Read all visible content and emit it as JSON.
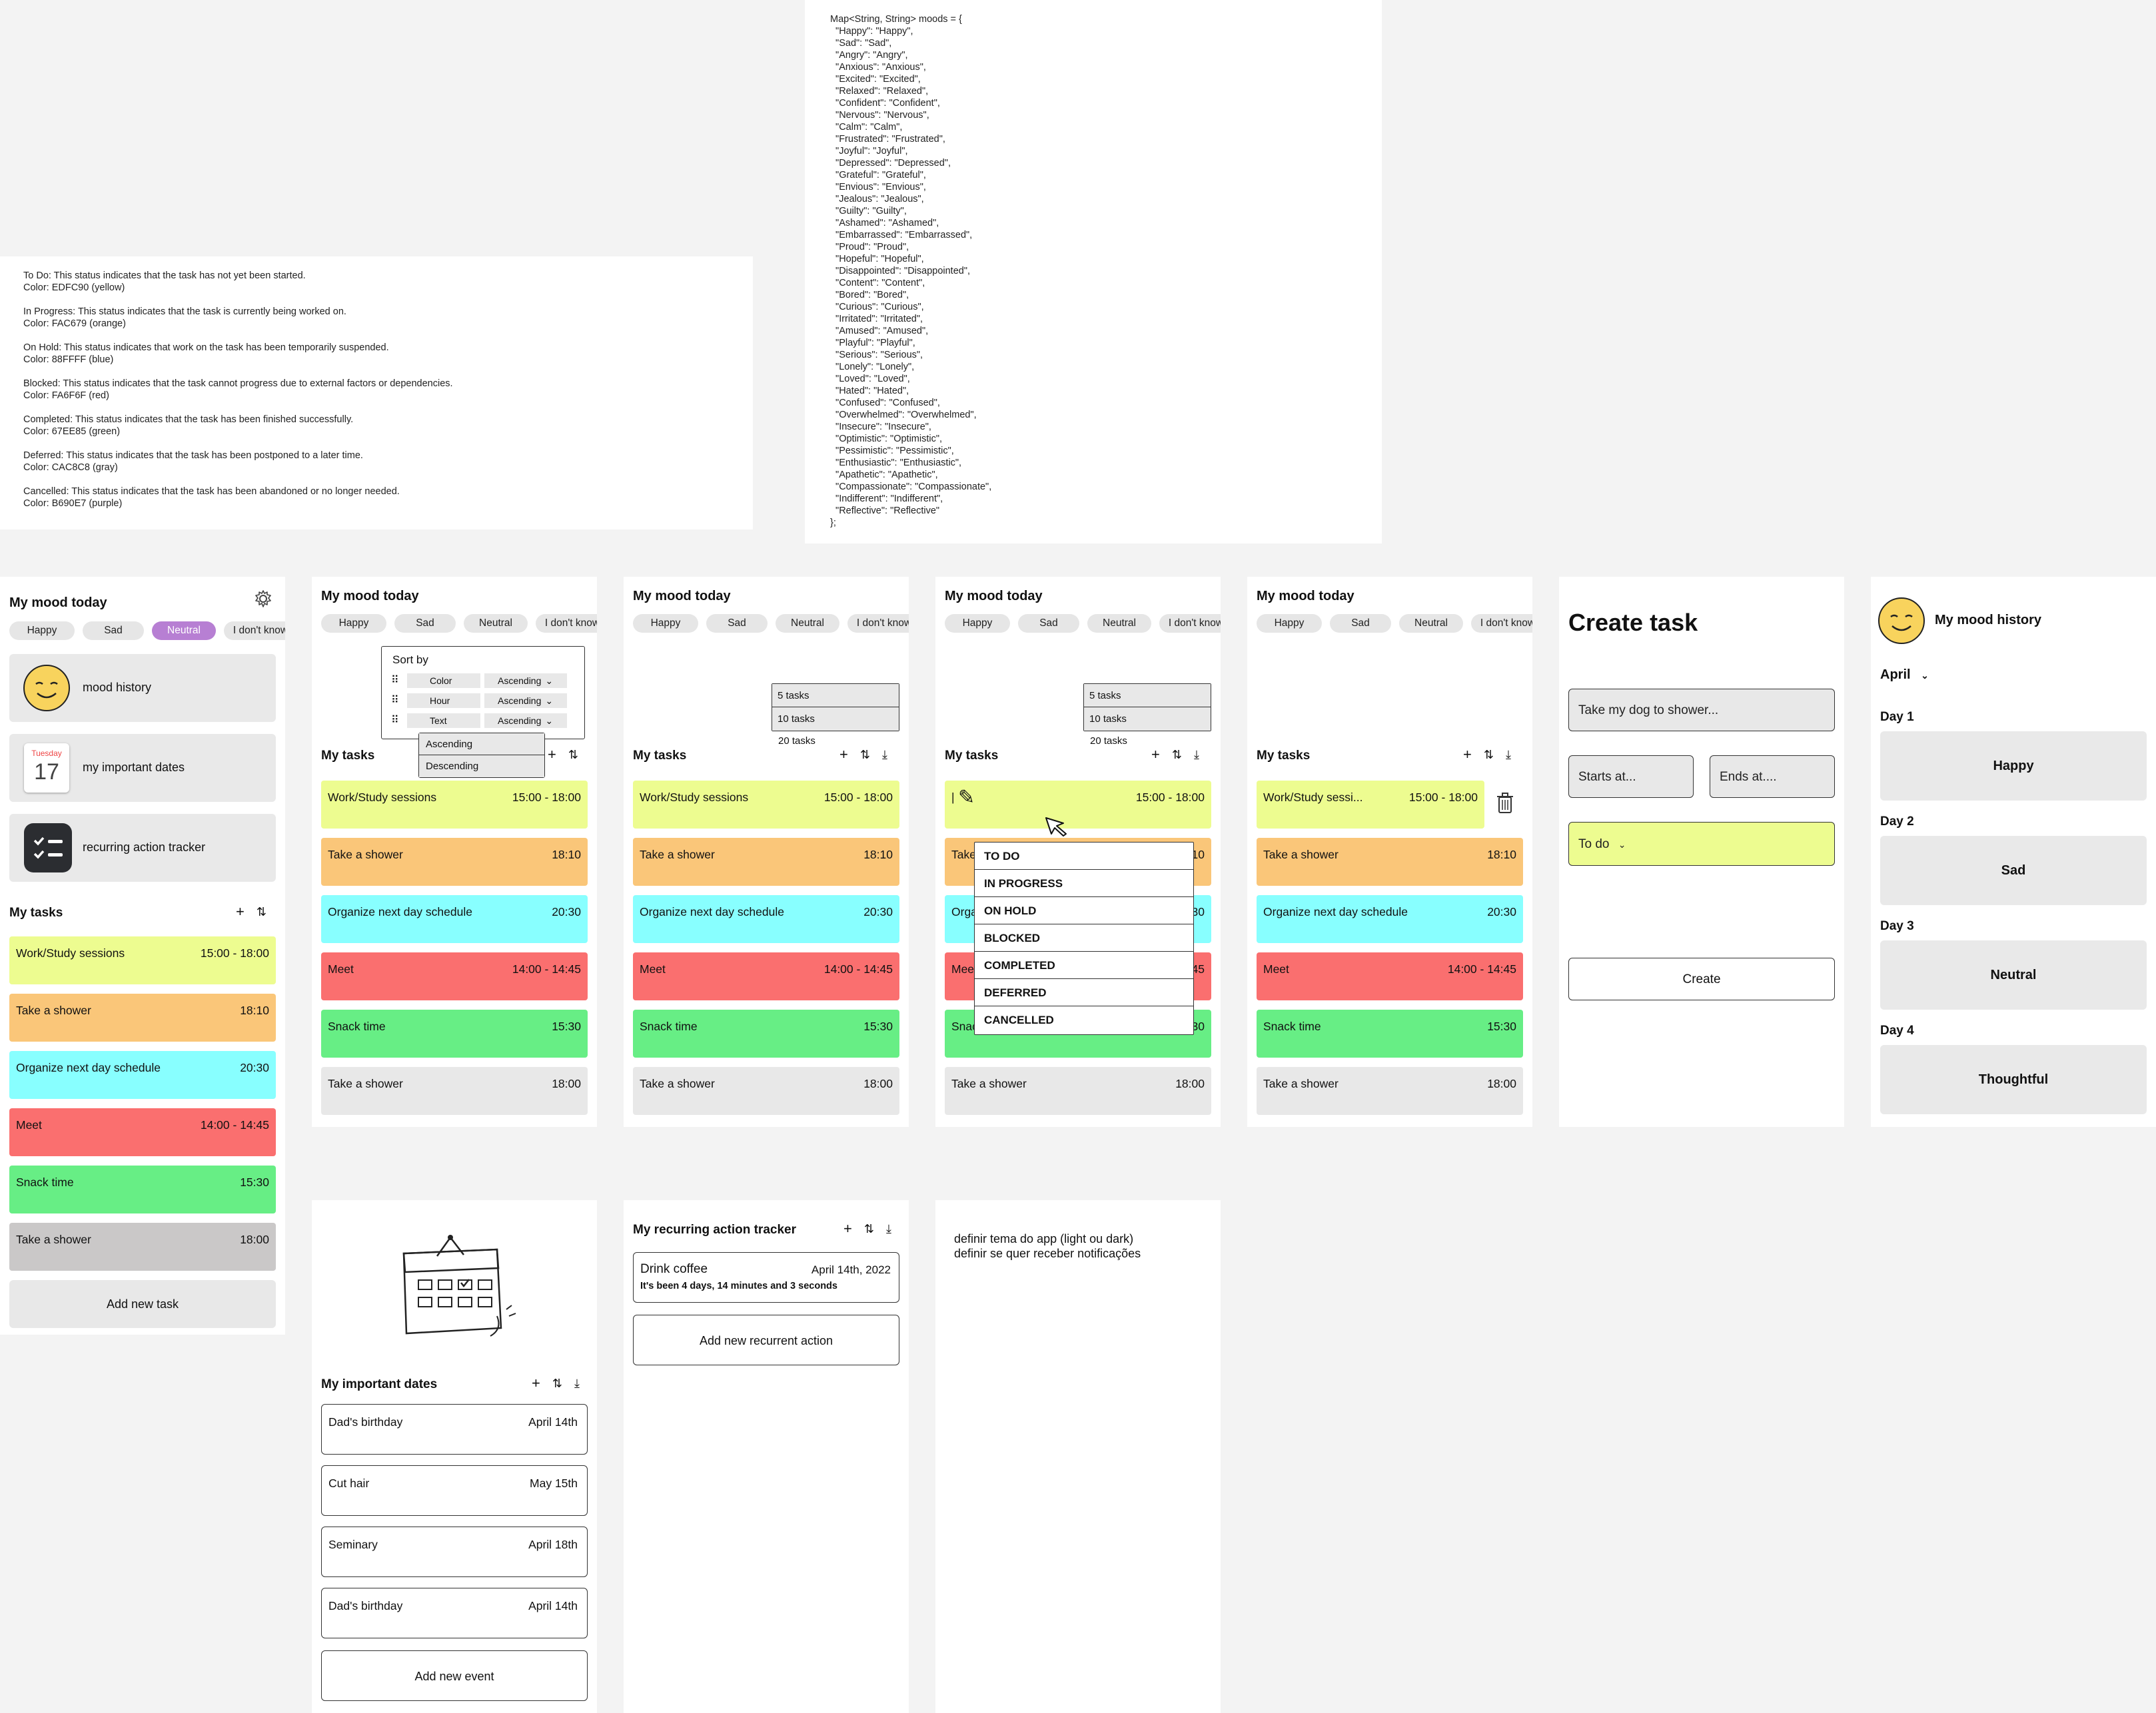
{
  "status_doc": {
    "lines": [
      "To Do: This status indicates that the task has not yet been started.",
      "Color: EDFC90 (yellow)",
      "",
      "In Progress: This status indicates that the task is currently being worked on.",
      "Color: FAC679 (orange)",
      "",
      "On Hold: This status indicates that work on the task has been temporarily suspended.",
      "Color: 88FFFF (blue)",
      "",
      "Blocked: This status indicates that the task cannot progress due to external factors or dependencies.",
      "Color: FA6F6F (red)",
      "",
      "Completed: This status indicates that the task has been finished successfully.",
      "Color: 67EE85 (green)",
      "",
      "Deferred: This status indicates that the task has been postponed to a later time.",
      "Color: CAC8C8 (gray)",
      "",
      "Cancelled: This status indicates that the task has been abandoned or no longer needed.",
      "Color: B690E7 (purple)"
    ]
  },
  "moods_doc": {
    "lines": [
      "Map<String, String> moods = {",
      "  \"Happy\": \"Happy\",",
      "  \"Sad\": \"Sad\",",
      "  \"Angry\": \"Angry\",",
      "  \"Anxious\": \"Anxious\",",
      "  \"Excited\": \"Excited\",",
      "  \"Relaxed\": \"Relaxed\",",
      "  \"Confident\": \"Confident\",",
      "  \"Nervous\": \"Nervous\",",
      "  \"Calm\": \"Calm\",",
      "  \"Frustrated\": \"Frustrated\",",
      "  \"Joyful\": \"Joyful\",",
      "  \"Depressed\": \"Depressed\",",
      "  \"Grateful\": \"Grateful\",",
      "  \"Envious\": \"Envious\",",
      "  \"Jealous\": \"Jealous\",",
      "  \"Guilty\": \"Guilty\",",
      "  \"Ashamed\": \"Ashamed\",",
      "  \"Embarrassed\": \"Embarrassed\",",
      "  \"Proud\": \"Proud\",",
      "  \"Hopeful\": \"Hopeful\",",
      "  \"Disappointed\": \"Disappointed\",",
      "  \"Content\": \"Content\",",
      "  \"Bored\": \"Bored\",",
      "  \"Curious\": \"Curious\",",
      "  \"Irritated\": \"Irritated\",",
      "  \"Amused\": \"Amused\",",
      "  \"Playful\": \"Playful\",",
      "  \"Serious\": \"Serious\",",
      "  \"Lonely\": \"Lonely\",",
      "  \"Loved\": \"Loved\",",
      "  \"Hated\": \"Hated\",",
      "  \"Confused\": \"Confused\",",
      "  \"Overwhelmed\": \"Overwhelmed\",",
      "  \"Insecure\": \"Insecure\",",
      "  \"Optimistic\": \"Optimistic\",",
      "  \"Pessimistic\": \"Pessimistic\",",
      "  \"Enthusiastic\": \"Enthusiastic\",",
      "  \"Apathetic\": \"Apathetic\",",
      "  \"Compassionate\": \"Compassionate\",",
      "  \"Indifferent\": \"Indifferent\",",
      "  \"Reflective\": \"Reflective\"",
      "};"
    ]
  },
  "colors": {
    "todo": "#edfc90",
    "in_progress": "#fac679",
    "on_hold": "#88ffff",
    "blocked": "#fa6f6f",
    "completed": "#67ee85",
    "deferred": "#cac8c8",
    "cancelled": "#b690e7"
  },
  "mood_today_title": "My mood today",
  "mood_chips": [
    "Happy",
    "Sad",
    "Neutral",
    "I don't know"
  ],
  "selected_mood": "Neutral",
  "home": {
    "cards": {
      "mood_history": "mood history",
      "important_dates": "my important dates",
      "recurring": "recurring action tracker"
    },
    "calendar_day": "Tuesday",
    "calendar_date": "17",
    "my_tasks": "My tasks",
    "add_task": "Add new task"
  },
  "tasks": [
    {
      "name": "Work/Study sessions",
      "time": "15:00 - 18:00",
      "color": "#edfc90"
    },
    {
      "name": "Take a shower",
      "time": "18:10",
      "color": "#fac679"
    },
    {
      "name": "Organize next day schedule",
      "time": "20:30",
      "color": "#88ffff"
    },
    {
      "name": "Meet",
      "time": "14:00 - 14:45",
      "color": "#fa6f6f"
    },
    {
      "name": "Snack time",
      "time": "15:30",
      "color": "#67ee85"
    },
    {
      "name": "Take a shower",
      "time": "18:00",
      "color": "#cac8c8"
    }
  ],
  "sort": {
    "title": "Sort by",
    "rows": [
      {
        "field": "Color",
        "order": "Ascending"
      },
      {
        "field": "Hour",
        "order": "Ascending"
      },
      {
        "field": "Text",
        "order": "Ascending"
      }
    ],
    "options": [
      "Ascending",
      "Descending"
    ]
  },
  "export": {
    "options": [
      "5 tasks",
      "10 tasks"
    ],
    "extra": "20 tasks"
  },
  "status_menu": [
    "TO DO",
    "IN PROGRESS",
    "ON HOLD",
    "BLOCKED",
    "COMPLETED",
    "DEFERRED",
    "CANCELLED"
  ],
  "edit_cursor": "|",
  "truncated_task": "Work/Study sessi...",
  "create": {
    "title": "Create task",
    "placeholder": "Take my dog to shower...",
    "starts": "Starts at...",
    "ends": "Ends at....",
    "status": "To do",
    "button": "Create"
  },
  "history": {
    "title": "My mood history",
    "month": "April",
    "days": [
      {
        "day": "Day 1",
        "mood": "Happy"
      },
      {
        "day": "Day 2",
        "mood": "Sad"
      },
      {
        "day": "Day 3",
        "mood": "Neutral"
      },
      {
        "day": "Day 4",
        "mood": "Thoughtful"
      }
    ]
  },
  "dates": {
    "title": "My important dates",
    "items": [
      {
        "name": "Dad's birthday",
        "date": "April 14th"
      },
      {
        "name": "Cut hair",
        "date": "May 15th"
      },
      {
        "name": "Seminary",
        "date": "April 18th"
      },
      {
        "name": "Dad's birthday",
        "date": "April 14th"
      }
    ],
    "add": "Add new event"
  },
  "recurring": {
    "title": "My recurring action tracker",
    "item_name": "Drink coffee",
    "item_date": "April 14th, 2022",
    "item_elapsed": "It's been 4 days, 14 minutes and 3 seconds",
    "add": "Add new recurrent action"
  },
  "settings_notes": {
    "line1": "definir tema do app (light ou dark)",
    "line2": "definir se quer receber notificações"
  }
}
